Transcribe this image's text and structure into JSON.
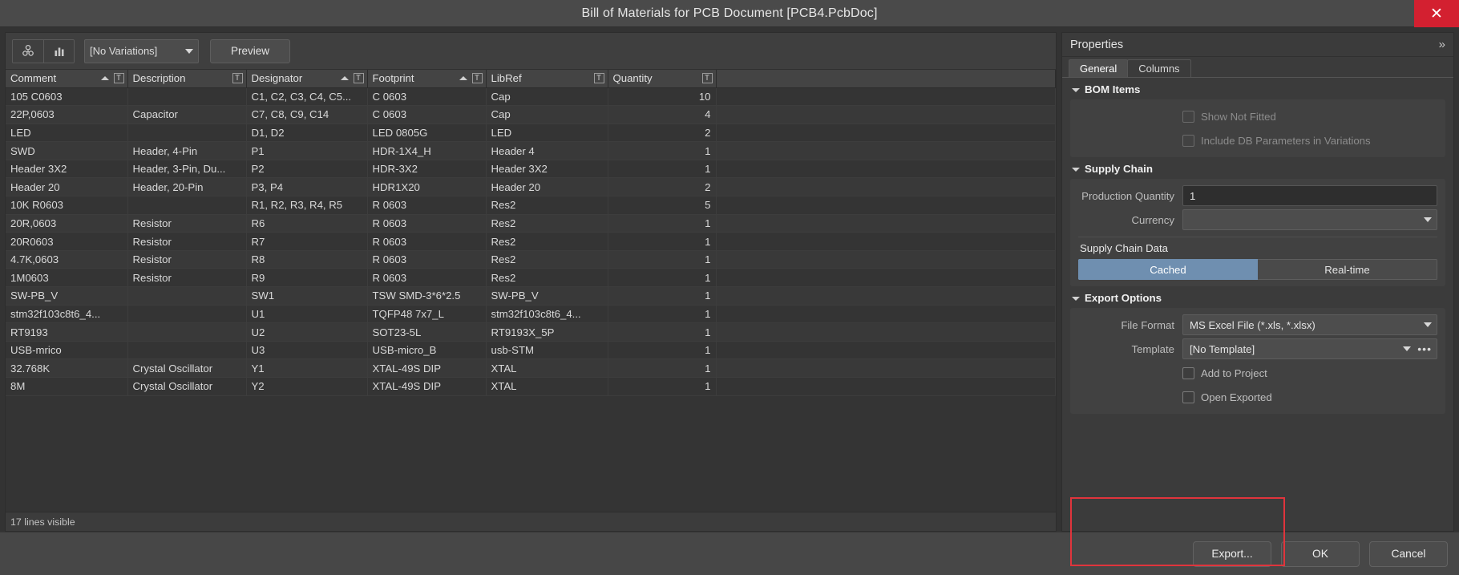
{
  "window": {
    "title": "Bill of Materials for PCB Document [PCB4.PcbDoc]",
    "close_label": "✕"
  },
  "toolbar": {
    "report_icon": "group-components-icon",
    "chart_icon": "bar-chart-icon",
    "variations_value": "[No Variations]",
    "preview_label": "Preview"
  },
  "table": {
    "columns": [
      {
        "label": "Comment",
        "sorted": true,
        "filter": "T"
      },
      {
        "label": "Description",
        "sorted": false,
        "filter": "T"
      },
      {
        "label": "Designator",
        "sorted": true,
        "filter": "T"
      },
      {
        "label": "Footprint",
        "sorted": true,
        "filter": "T"
      },
      {
        "label": "LibRef",
        "sorted": false,
        "filter": "T"
      },
      {
        "label": "Quantity",
        "sorted": false,
        "filter": "T"
      }
    ],
    "rows": [
      {
        "comment": "105 C0603",
        "description": "",
        "designator": "C1, C2, C3, C4, C5...",
        "footprint": "C 0603",
        "libref": "Cap",
        "quantity": "10"
      },
      {
        "comment": "22P,0603",
        "description": "Capacitor",
        "designator": "C7, C8, C9, C14",
        "footprint": "C 0603",
        "libref": "Cap",
        "quantity": "4"
      },
      {
        "comment": "LED",
        "description": "",
        "designator": "D1, D2",
        "footprint": "LED 0805G",
        "libref": "LED",
        "quantity": "2"
      },
      {
        "comment": "SWD",
        "description": "Header, 4-Pin",
        "designator": "P1",
        "footprint": "HDR-1X4_H",
        "libref": "Header 4",
        "quantity": "1"
      },
      {
        "comment": "Header 3X2",
        "description": "Header, 3-Pin, Du...",
        "designator": "P2",
        "footprint": "HDR-3X2",
        "libref": "Header 3X2",
        "quantity": "1"
      },
      {
        "comment": "Header 20",
        "description": "Header, 20-Pin",
        "designator": "P3, P4",
        "footprint": "HDR1X20",
        "libref": "Header 20",
        "quantity": "2"
      },
      {
        "comment": "10K R0603",
        "description": "",
        "designator": "R1, R2, R3, R4, R5",
        "footprint": "R 0603",
        "libref": "Res2",
        "quantity": "5"
      },
      {
        "comment": "20R,0603",
        "description": "Resistor",
        "designator": "R6",
        "footprint": "R 0603",
        "libref": "Res2",
        "quantity": "1"
      },
      {
        "comment": "20R0603",
        "description": "Resistor",
        "designator": "R7",
        "footprint": "R 0603",
        "libref": "Res2",
        "quantity": "1"
      },
      {
        "comment": "4.7K,0603",
        "description": "Resistor",
        "designator": "R8",
        "footprint": "R 0603",
        "libref": "Res2",
        "quantity": "1"
      },
      {
        "comment": "1M0603",
        "description": "Resistor",
        "designator": "R9",
        "footprint": "R 0603",
        "libref": "Res2",
        "quantity": "1"
      },
      {
        "comment": "SW-PB_V",
        "description": "",
        "designator": "SW1",
        "footprint": "TSW SMD-3*6*2.5",
        "libref": "SW-PB_V",
        "quantity": "1"
      },
      {
        "comment": "stm32f103c8t6_4...",
        "description": "",
        "designator": "U1",
        "footprint": "TQFP48 7x7_L",
        "libref": "stm32f103c8t6_4...",
        "quantity": "1"
      },
      {
        "comment": "RT9193",
        "description": "",
        "designator": "U2",
        "footprint": "SOT23-5L",
        "libref": "RT9193X_5P",
        "quantity": "1"
      },
      {
        "comment": "USB-mrico",
        "description": "",
        "designator": "U3",
        "footprint": "USB-micro_B",
        "libref": "usb-STM",
        "quantity": "1"
      },
      {
        "comment": "32.768K",
        "description": "Crystal Oscillator",
        "designator": "Y1",
        "footprint": "XTAL-49S DIP",
        "libref": "XTAL",
        "quantity": "1"
      },
      {
        "comment": "8M",
        "description": "Crystal Oscillator",
        "designator": "Y2",
        "footprint": "XTAL-49S DIP",
        "libref": "XTAL",
        "quantity": "1"
      }
    ],
    "status": "17 lines visible"
  },
  "properties": {
    "title": "Properties",
    "collapse_icon": "»",
    "tabs": [
      {
        "label": "General",
        "active": true
      },
      {
        "label": "Columns",
        "active": false
      }
    ],
    "bom_items": {
      "section_title": "BOM Items",
      "show_not_fitted_label": "Show Not Fitted",
      "show_not_fitted_checked": false,
      "include_db_label": "Include DB Parameters in Variations",
      "include_db_checked": false
    },
    "supply_chain": {
      "section_title": "Supply Chain",
      "production_quantity_label": "Production Quantity",
      "production_quantity_value": "1",
      "currency_label": "Currency",
      "currency_value": "",
      "supply_chain_data_label": "Supply Chain Data",
      "cached_label": "Cached",
      "realtime_label": "Real-time",
      "selected_mode": "Cached",
      "accent_color": "#6f8fb0"
    },
    "export_options": {
      "section_title": "Export Options",
      "file_format_label": "File Format",
      "file_format_value": "MS Excel File (*.xls, *.xlsx)",
      "template_label": "Template",
      "template_value": "[No Template]",
      "template_browse_icon": "•••",
      "add_to_project_label": "Add to Project",
      "add_to_project_checked": false,
      "open_exported_label": "Open Exported",
      "open_exported_checked": false
    }
  },
  "footer": {
    "export_label": "Export...",
    "ok_label": "OK",
    "cancel_label": "Cancel",
    "highlight_color": "#e0343c"
  }
}
